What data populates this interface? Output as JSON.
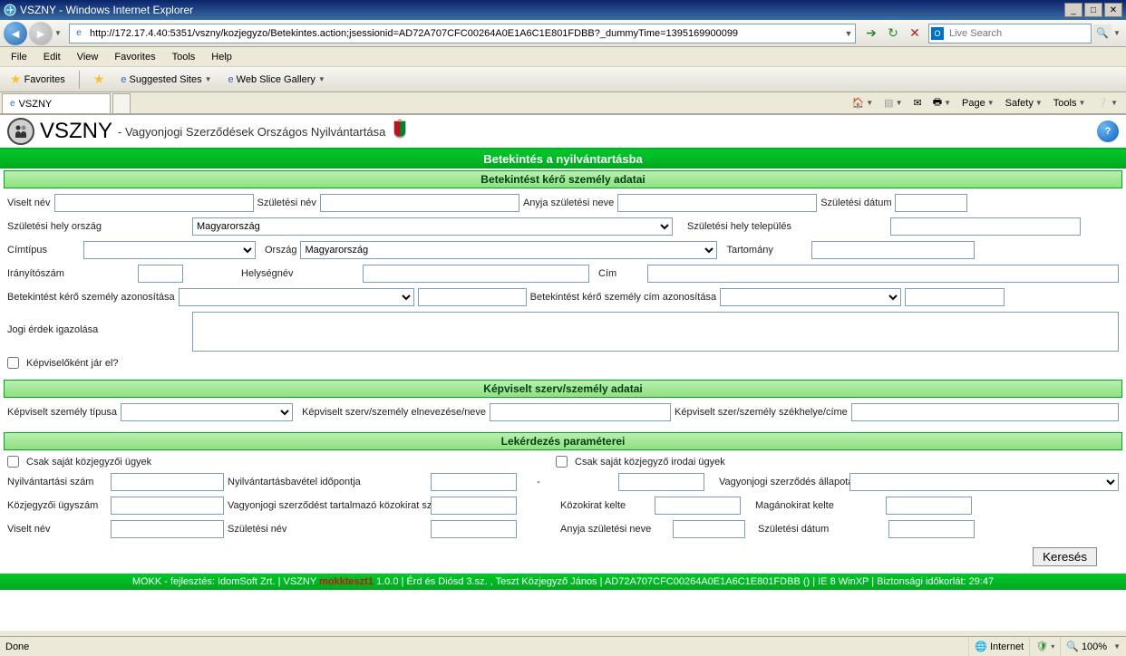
{
  "window": {
    "title": "VSZNY - Windows Internet Explorer",
    "min_btn": "_",
    "max_btn": "□",
    "close_btn": "✕"
  },
  "nav": {
    "url": "http://172.17.4.40:5351/vszny/kozjegyzo/Betekintes.action;jsessionid=AD72A707CFC00264A0E1A6C1E801FDBB?_dummyTime=1395169900099",
    "search_placeholder": "Live Search"
  },
  "menu": {
    "file": "File",
    "edit": "Edit",
    "view": "View",
    "favorites": "Favorites",
    "tools": "Tools",
    "help": "Help"
  },
  "favbar": {
    "favorites": "Favorites",
    "suggested": "Suggested Sites",
    "webslice": "Web Slice Gallery"
  },
  "tab": {
    "title": "VSZNY"
  },
  "tabtools": {
    "page": "Page",
    "safety": "Safety",
    "tools": "Tools"
  },
  "app": {
    "title": "VSZNY",
    "subtitle": " - Vagyonjogi Szerződések Országos Nyilvántartása",
    "mainbar": "Betekintés a nyilvántartásba",
    "section1": "Betekintést kérő személy adatai",
    "section2": "Képviselt szerv/személy adatai",
    "section3": "Lekérdezés paraméterei",
    "labels": {
      "viselt_nev": "Viselt név",
      "szuletesi_nev": "Születési név",
      "anyja_neve": "Anyja születési neve",
      "szuletesi_datum": "Születési dátum",
      "szul_hely_orszag": "Születési hely ország",
      "szul_hely_telepules": "Születési hely település",
      "cimtipus": "Címtípus",
      "orszag": "Ország",
      "tartomany": "Tartomány",
      "iranyitoszam": "Irányítószám",
      "helysegnev": "Helységnév",
      "cim": "Cím",
      "azon": "Betekintést kérő személy azonosítása",
      "cim_azon": "Betekintést kérő személy cím azonosítása",
      "jogi_erdek": "Jogi érdek igazolása",
      "kepviselokent": "Képviselőként jár el?",
      "kepviselt_tipus": "Képviselt személy típusa",
      "kepviselt_nev": "Képviselt szerv/személy elnevezése/neve",
      "kepviselt_szekhely": "Képviselt szer/személy székhelye/címe",
      "csak_sajat": "Csak saját közjegyzői ügyek",
      "csak_sajat_irodai": "Csak saját közjegyző irodai ügyek",
      "nyilv_szam": "Nyilvántartási szám",
      "nyilv_ido": "Nyilvántartásbavétel időpontja",
      "dash": "-",
      "szerz_allapot": "Vagyonjogi szerződés állapota",
      "kozjegyzoi_ugyszam": "Közjegyzői ügyszám",
      "kozokirat_szam": "Vagyonjogi szerződést tartalmazó közokirat száma",
      "kozokirat_kelte": "Közokirat kelte",
      "maganokirat_kelte": "Magánokirat kelte",
      "q_viselt_nev": "Viselt név",
      "q_szuletesi_nev": "Születési név",
      "q_anyja_neve": "Anyja születési neve",
      "q_szuletesi_datum": "Születési dátum",
      "kereses": "Keresés"
    },
    "values": {
      "szul_hely_orszag": "Magyarország",
      "orszag": "Magyarország"
    },
    "footer_pre": "MOKK - fejlesztés: IdomSoft Zrt.  |  VSZNY ",
    "footer_red": "mokkteszt1",
    "footer_post": " 1.0.0  |  Érd és Diósd 3.sz. , Teszt Közjegyző János  |  AD72A707CFC00264A0E1A6C1E801FDBB ()  |  IE 8 WinXP  |  Biztonsági időkorlát:  29:47"
  },
  "status": {
    "done": "Done",
    "internet": "Internet",
    "zoom": "100%"
  }
}
